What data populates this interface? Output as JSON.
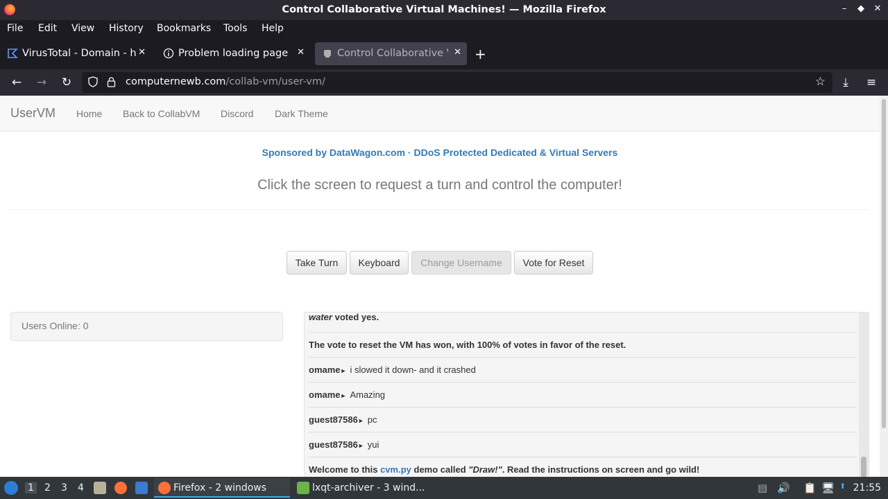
{
  "window": {
    "title": "Control Collaborative Virtual Machines! — Mozilla Firefox",
    "min": "–",
    "restore": "◆",
    "close": "✕"
  },
  "menu": [
    "File",
    "Edit",
    "View",
    "History",
    "Bookmarks",
    "Tools",
    "Help"
  ],
  "tabs": [
    {
      "label": "VirusTotal - Domain - hax",
      "icon": "virustotal-icon",
      "close": "✕"
    },
    {
      "label": "Problem loading page",
      "icon": "info-icon",
      "close": "✕"
    },
    {
      "label": "Control Collaborative Virt",
      "icon": "collabvm-icon",
      "close": "✕",
      "active": true
    }
  ],
  "newtab": "+",
  "nav": {
    "back": "←",
    "forward": "→",
    "reload": "↻",
    "url_host": "computernewb.com",
    "url_path": "/collab-vm/user-vm/",
    "star": "☆",
    "downloads": "⤓",
    "menu": "≡"
  },
  "site": {
    "brand": "UserVM",
    "links": [
      "Home",
      "Back to CollabVM",
      "Discord",
      "Dark Theme"
    ],
    "sponsor": "Sponsored by DataWagon.com · DDoS Protected Dedicated & Virtual Servers",
    "subhead": "Click the screen to request a turn and control the computer!",
    "buttons": [
      "Take Turn",
      "Keyboard",
      "Change Username",
      "Vote for Reset"
    ],
    "users_online": "Users Online: 0"
  },
  "chat": {
    "vote_user": "water",
    "vote_text": "voted yes.",
    "reset_msg": "The vote to reset the VM has won, with 100% of votes in favor of the reset.",
    "messages": [
      {
        "user": "omame",
        "text": "i slowed it down- and it crashed"
      },
      {
        "user": "omame",
        "text": "Amazing"
      },
      {
        "user": "guest87586",
        "text": "pc"
      },
      {
        "user": "guest87586",
        "text": "yui"
      }
    ],
    "welcome_a": "Welcome to this",
    "welcome_link": "cvm.py",
    "welcome_b": "demo called",
    "welcome_name": "\"Draw!\"",
    "welcome_c": ". Read the instructions on screen and go wild!"
  },
  "taskbar": {
    "workspaces": [
      "1",
      "2",
      "3",
      "4"
    ],
    "tasks": [
      "Firefox - 2 windows",
      "lxqt-archiver - 3 wind..."
    ],
    "clock": "21:55"
  }
}
